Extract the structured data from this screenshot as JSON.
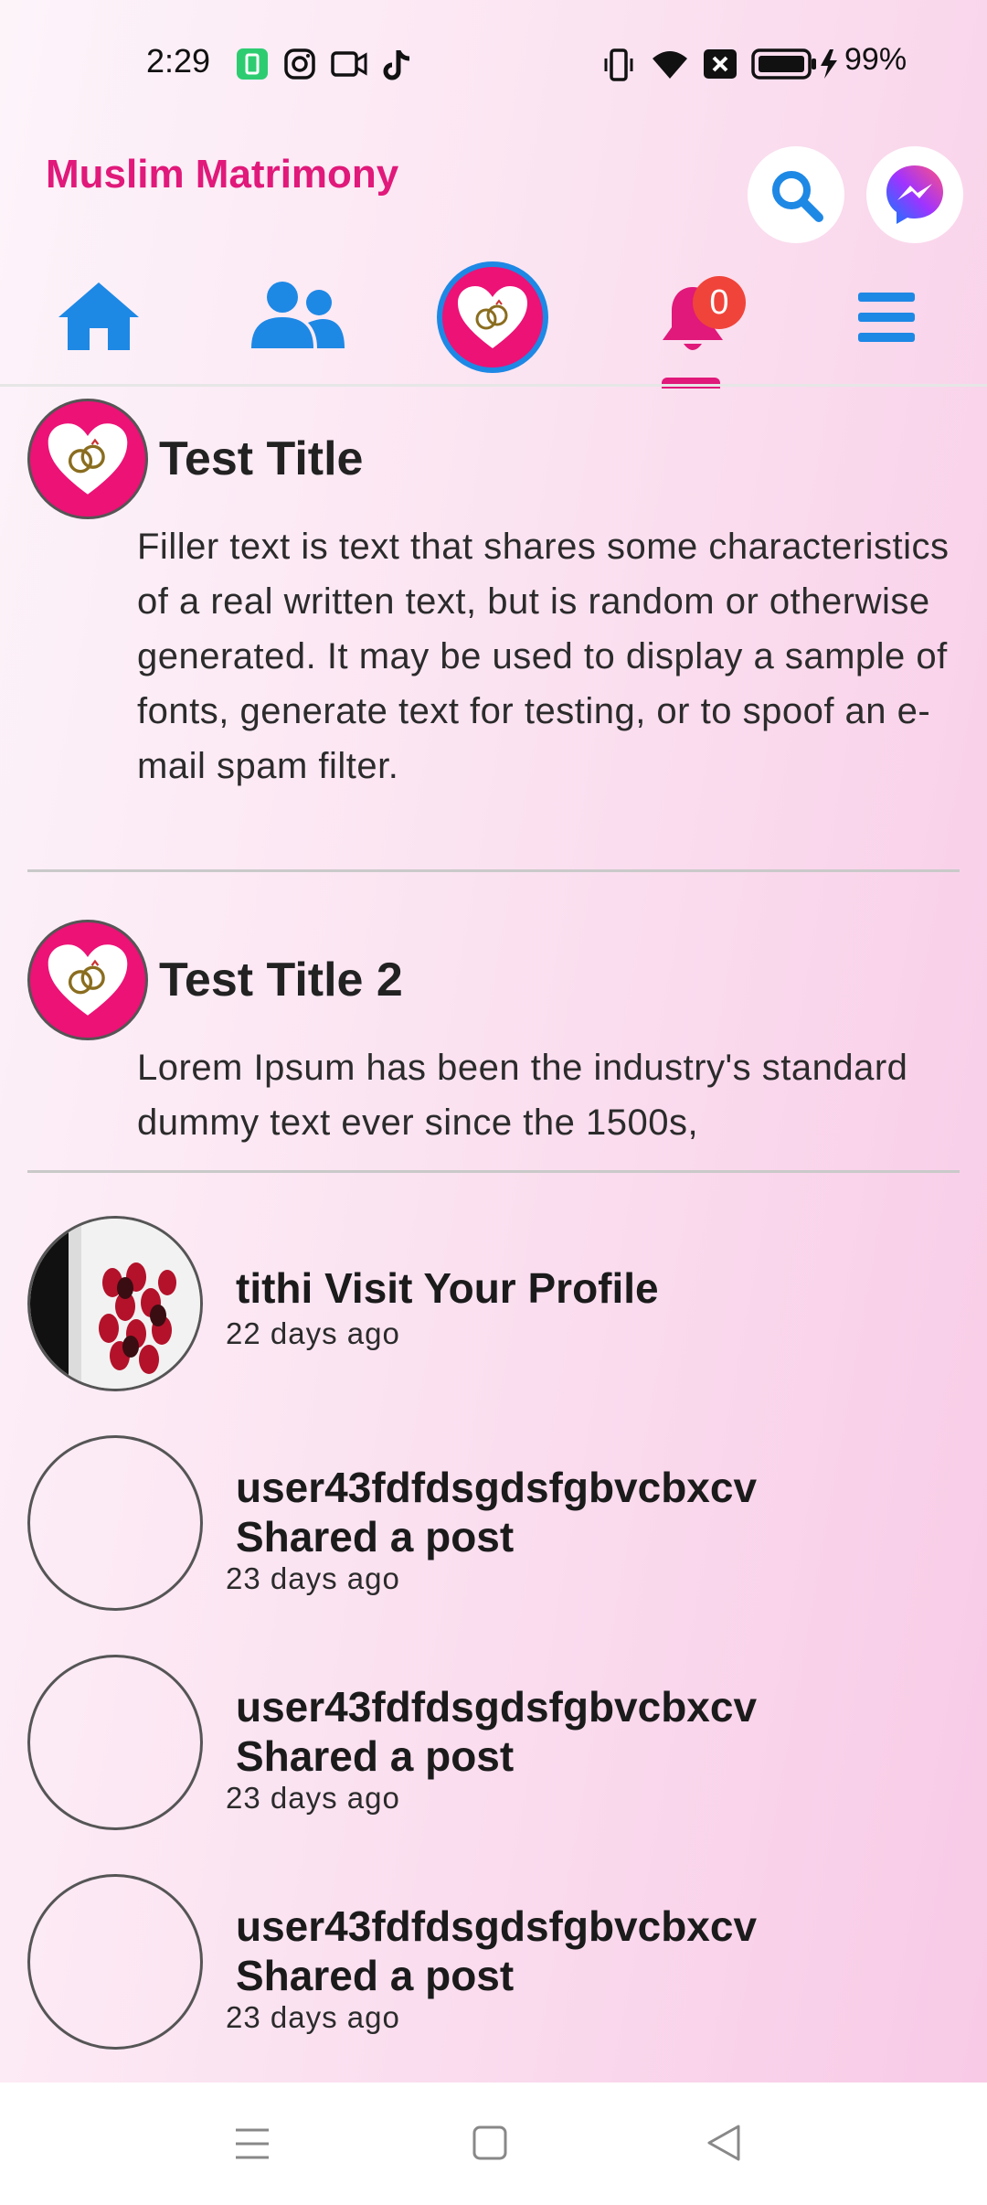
{
  "status_bar": {
    "time": "2:29",
    "battery": "99%"
  },
  "app": {
    "title": "Muslim Matrimony"
  },
  "nav": {
    "items": [
      "home-icon",
      "people-icon",
      "matrimony-logo-icon",
      "bell-icon",
      "menu-icon"
    ],
    "active": "notifications",
    "notification_count": "0"
  },
  "posts": [
    {
      "title": "Test Title",
      "body": "Filler text is text that shares some characteristics of a real written text, but is random or otherwise generated. It may be used to display a sample of fonts, generate text for testing, or to spoof an e-mail spam filter."
    },
    {
      "title": "Test Title 2",
      "body": "Lorem Ipsum has been the industry's standard dummy text ever since the 1500s,"
    }
  ],
  "notifications": [
    {
      "line1": "tithi Visit Your Profile",
      "line2": "",
      "time": "22 days ago"
    },
    {
      "line1": "user43fdfdsgdsfgbvcbxcv",
      "line2": "Shared a post",
      "time": "23 days ago"
    },
    {
      "line1": "user43fdfdsgdsfgbvcbxcv",
      "line2": "Shared a post",
      "time": "23 days ago"
    },
    {
      "line1": "user43fdfdsgdsfgbvcbxcv",
      "line2": "Shared a post",
      "time": "23 days ago"
    }
  ],
  "colors": {
    "brand": "#e0197a",
    "nav_blue": "#1e88e5",
    "badge": "#f0443a"
  }
}
